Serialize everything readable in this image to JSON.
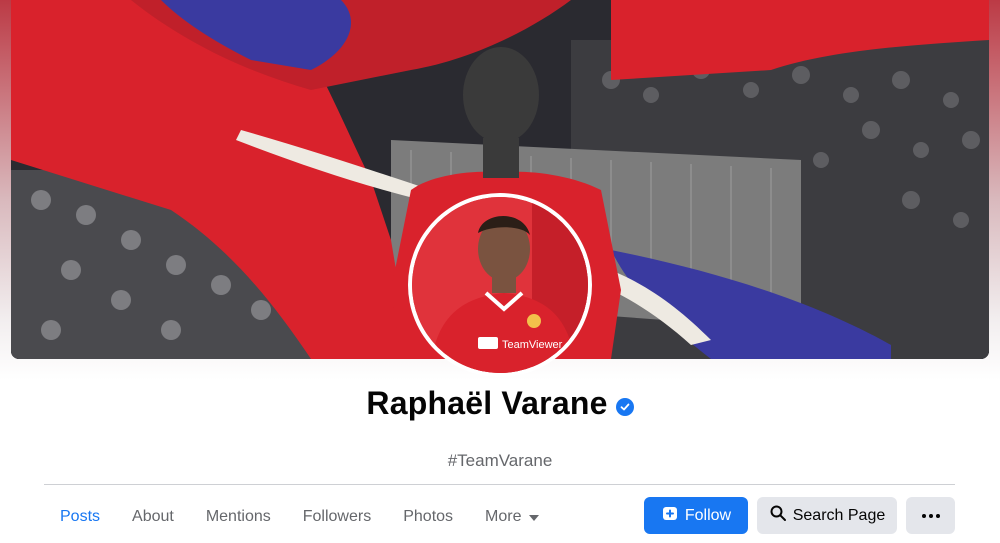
{
  "page": {
    "name": "Raphaël Varane",
    "tagline": "#TeamVarane",
    "verified": true
  },
  "tabs": [
    {
      "label": "Posts",
      "active": true
    },
    {
      "label": "About",
      "active": false
    },
    {
      "label": "Mentions",
      "active": false
    },
    {
      "label": "Followers",
      "active": false
    },
    {
      "label": "Photos",
      "active": false
    },
    {
      "label": "More",
      "active": false
    }
  ],
  "actions": {
    "follow_label": "Follow",
    "search_label": "Search Page",
    "more_icon": "ellipsis-icon"
  },
  "cover": {
    "sponsor_text": "TeamViewer"
  },
  "colors": {
    "accent": "#1877f2",
    "kit_red": "#d9222c",
    "cover_blue": "#3a3aa0"
  }
}
